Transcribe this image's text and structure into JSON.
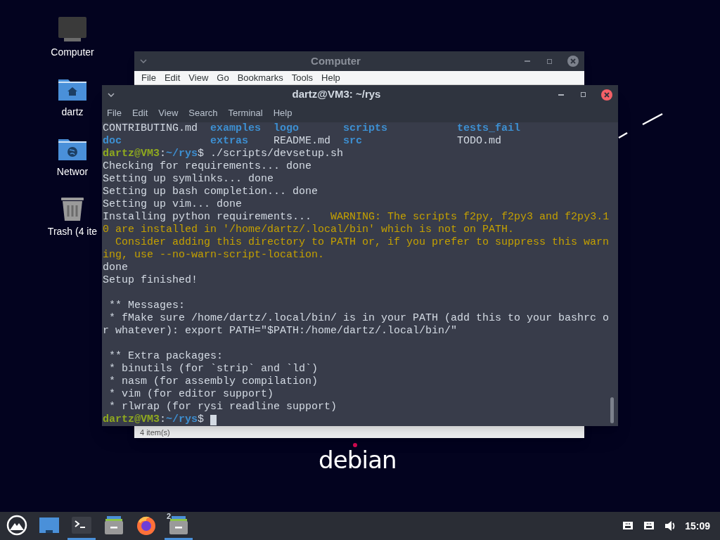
{
  "desktop_icons": [
    {
      "kind": "computer",
      "label": "Computer"
    },
    {
      "kind": "home",
      "label": "dartz"
    },
    {
      "kind": "network",
      "label": "Networ"
    },
    {
      "kind": "trash",
      "label": "Trash (4 ite"
    }
  ],
  "file_manager": {
    "title": "Computer",
    "menu": [
      "File",
      "Edit",
      "View",
      "Go",
      "Bookmarks",
      "Tools",
      "Help"
    ],
    "status": "4 item(s)"
  },
  "terminal": {
    "title": "dartz@VM3: ~/rys",
    "menu": [
      "File",
      "Edit",
      "View",
      "Search",
      "Terminal",
      "Help"
    ],
    "lines": [
      {
        "kind": "ls",
        "entries": [
          {
            "kind": "file",
            "text": "CONTRIBUTING.md"
          },
          {
            "kind": "dir",
            "text": "examples"
          },
          {
            "kind": "dir",
            "text": "logo"
          },
          {
            "kind": "dir",
            "text": "scripts"
          },
          {
            "kind": "dir",
            "text": "tests_fail"
          }
        ]
      },
      {
        "kind": "ls",
        "entries": [
          {
            "kind": "dir",
            "text": "doc"
          },
          {
            "kind": "dir",
            "text": "extras"
          },
          {
            "kind": "file",
            "text": "README.md"
          },
          {
            "kind": "dir",
            "text": "src"
          },
          {
            "kind": "file",
            "text": "TODO.md"
          }
        ]
      },
      {
        "kind": "text",
        "segments": [
          {
            "kind": "user",
            "text": "dartz@VM3"
          },
          {
            "kind": "plain",
            "text": ":"
          },
          {
            "kind": "path",
            "text": "~/rys"
          },
          {
            "kind": "plain",
            "text": "$ ./scripts/devsetup.sh"
          }
        ]
      },
      {
        "kind": "text",
        "segments": [
          {
            "kind": "plain",
            "text": "Checking for requirements... done"
          }
        ]
      },
      {
        "kind": "text",
        "segments": [
          {
            "kind": "plain",
            "text": "Setting up symlinks... done"
          }
        ]
      },
      {
        "kind": "text",
        "segments": [
          {
            "kind": "plain",
            "text": "Setting up bash completion... done"
          }
        ]
      },
      {
        "kind": "text",
        "segments": [
          {
            "kind": "plain",
            "text": "Setting up vim... done"
          }
        ]
      },
      {
        "kind": "text",
        "segments": [
          {
            "kind": "plain",
            "text": "Installing python requirements..."
          },
          {
            "kind": "warning",
            "text": "   WARNING: The scripts f2py, f2py3 and f2py3.1"
          }
        ]
      },
      {
        "kind": "text",
        "segments": [
          {
            "kind": "warning",
            "text": "0 are installed in '/home/dartz/.local/bin' which is not on PATH."
          }
        ]
      },
      {
        "kind": "text",
        "segments": [
          {
            "kind": "warning",
            "text": "  Consider adding this directory to PATH or, if you prefer to suppress this warn"
          }
        ]
      },
      {
        "kind": "text",
        "segments": [
          {
            "kind": "warning",
            "text": "ing, use --no-warn-script-location."
          }
        ]
      },
      {
        "kind": "text",
        "segments": [
          {
            "kind": "plain",
            "text": "done"
          }
        ]
      },
      {
        "kind": "text",
        "segments": [
          {
            "kind": "plain",
            "text": "Setup finished!"
          }
        ]
      },
      {
        "kind": "blank"
      },
      {
        "kind": "text",
        "segments": [
          {
            "kind": "plain",
            "text": " ** Messages:"
          }
        ]
      },
      {
        "kind": "text",
        "segments": [
          {
            "kind": "plain",
            "text": " * fMake sure /home/dartz/.local/bin/ is in your PATH (add this to your bashrc o"
          }
        ]
      },
      {
        "kind": "text",
        "segments": [
          {
            "kind": "plain",
            "text": "r whatever): export PATH=\"$PATH:/home/dartz/.local/bin/\""
          }
        ]
      },
      {
        "kind": "blank"
      },
      {
        "kind": "text",
        "segments": [
          {
            "kind": "plain",
            "text": " ** Extra packages:"
          }
        ]
      },
      {
        "kind": "text",
        "segments": [
          {
            "kind": "plain",
            "text": " * binutils (for `strip` and `ld`)"
          }
        ]
      },
      {
        "kind": "text",
        "segments": [
          {
            "kind": "plain",
            "text": " * nasm (for assembly compilation)"
          }
        ]
      },
      {
        "kind": "text",
        "segments": [
          {
            "kind": "plain",
            "text": " * vim (for editor support)"
          }
        ]
      },
      {
        "kind": "text",
        "segments": [
          {
            "kind": "plain",
            "text": " * rlwrap (for rysi readline support)"
          }
        ]
      },
      {
        "kind": "text",
        "segments": [
          {
            "kind": "user",
            "text": "dartz@VM3"
          },
          {
            "kind": "plain",
            "text": ":"
          },
          {
            "kind": "path",
            "text": "~/rys"
          },
          {
            "kind": "plain",
            "text": "$"
          },
          {
            "kind": "cursor"
          }
        ]
      }
    ]
  },
  "wallpaper": {
    "logo": "debian"
  },
  "taskbar": {
    "items": [
      {
        "kind": "launcher",
        "active": false
      },
      {
        "kind": "desktop",
        "active": false
      },
      {
        "kind": "terminal",
        "active": true
      },
      {
        "kind": "files",
        "active": false
      },
      {
        "kind": "browser",
        "active": false
      },
      {
        "kind": "files",
        "active": true,
        "badge": "2"
      }
    ],
    "tray": [
      {
        "kind": "network"
      },
      {
        "kind": "network"
      },
      {
        "kind": "volume"
      }
    ],
    "clock": "15:09"
  }
}
